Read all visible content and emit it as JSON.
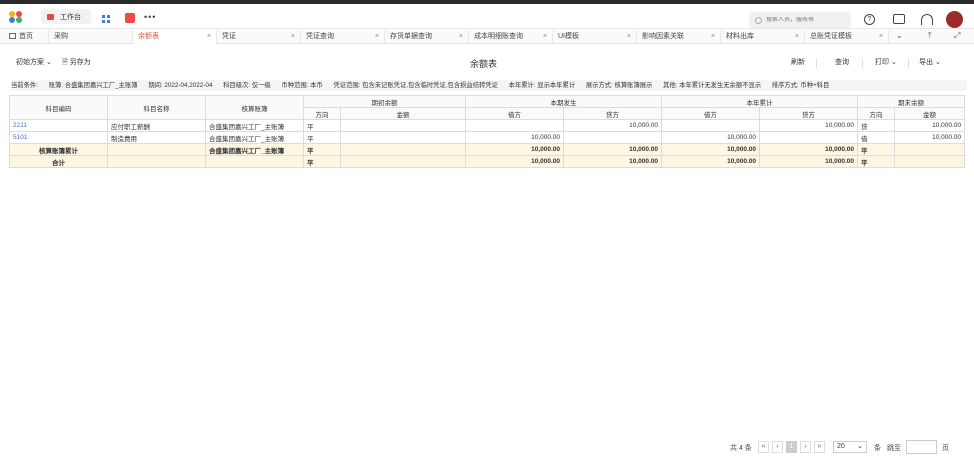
{
  "topbar": {
    "workbench_label": "工作台",
    "more_label": "•••",
    "search_placeholder": "搜索人员，服务等"
  },
  "tabs": [
    {
      "label": "首页"
    },
    {
      "label": "采购"
    },
    {
      "label": "余额表",
      "close": "×"
    },
    {
      "label": "凭证",
      "close": "×"
    },
    {
      "label": "凭证查询",
      "close": "×"
    },
    {
      "label": "存货单据查询",
      "close": "×"
    },
    {
      "label": "成本明细账查询",
      "close": "×"
    },
    {
      "label": "UI模板",
      "close": "×"
    },
    {
      "label": "影响因素关联",
      "close": "×"
    },
    {
      "label": "材料出库",
      "close": "×"
    },
    {
      "label": "总账凭证模板",
      "close": "×"
    }
  ],
  "toolbar": {
    "plan_label": "初始方案",
    "save_as_label": "另存为",
    "title": "余额表",
    "refresh_label": "刷新",
    "query_label": "查询",
    "print_label": "打印",
    "export_label": "导出"
  },
  "conditions": [
    "当前条件:",
    "账簿: 合盛集团嘉兴工厂_主账簿",
    "期间: 2022-04,2022-04",
    "科目级次: 仅一级",
    "币种范围: 本币",
    "凭证范围: 包含未记账凭证,包含临时凭证,包含损益结转凭证",
    "本年累计: 显示本年累计",
    "展示方式: 核算账簿展示",
    "其他: 本年累计无发生无余额不显示",
    "排序方式: 币种+科目"
  ],
  "table": {
    "headers": {
      "code": "科目编码",
      "name": "科目名称",
      "book": "核算账簿",
      "opening": "期初余额",
      "current": "本期发生",
      "ytd": "本年累计",
      "closing": "期末余额",
      "direction": "方向",
      "amount": "金额",
      "debit": "借方",
      "credit": "贷方"
    },
    "rows": [
      {
        "code": "2211",
        "name": "应付职工薪酬",
        "book": "合盛集团嘉兴工厂_主账簿",
        "open_dir": "平",
        "open_amt": "",
        "cur_debit": "",
        "cur_credit": "10,000.00",
        "ytd_debit": "",
        "ytd_credit": "10,000.00",
        "close_dir": "贷",
        "close_amt": "10,000.00"
      },
      {
        "code": "5101",
        "name": "制造费用",
        "book": "合盛集团嘉兴工厂_主账簿",
        "open_dir": "平",
        "open_amt": "",
        "cur_debit": "10,000.00",
        "cur_credit": "",
        "ytd_debit": "10,000.00",
        "ytd_credit": "",
        "close_dir": "借",
        "close_amt": "10,000.00"
      }
    ],
    "subtotal": {
      "label": "核算账簿累计",
      "book": "合盛集团嘉兴工厂_主账簿",
      "open_dir": "平",
      "cur_debit": "10,000.00",
      "cur_credit": "10,000.00",
      "ytd_debit": "10,000.00",
      "ytd_credit": "10,000.00",
      "close_dir": "平"
    },
    "total": {
      "label": "合计",
      "open_dir": "平",
      "cur_debit": "10,000.00",
      "cur_credit": "10,000.00",
      "ytd_debit": "10,000.00",
      "ytd_credit": "10,000.00",
      "close_dir": "平"
    }
  },
  "pagination": {
    "total_label": "共 4 条",
    "first": "«",
    "prev": "‹",
    "current_page": "1",
    "next": "›",
    "last": "»",
    "page_size": "20",
    "per_label": "条",
    "goto_label": "跳至",
    "page_label": "页"
  }
}
